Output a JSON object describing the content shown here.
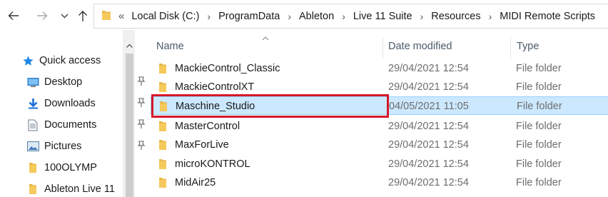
{
  "toolbar": {
    "back_icon": "arrow-left-icon",
    "forward_icon": "arrow-right-icon",
    "recent_icon": "chevron-down-icon",
    "up_icon": "arrow-up-icon"
  },
  "address_bar": {
    "overflow": "«",
    "crumbs": [
      "Local Disk (C:)",
      "ProgramData",
      "Ableton",
      "Live 11 Suite",
      "Resources",
      "MIDI Remote Scripts"
    ],
    "separator": "›"
  },
  "sidebar": {
    "items": [
      {
        "label": "Quick access",
        "icon": "star-icon",
        "pinned": false
      },
      {
        "label": "Desktop",
        "icon": "desktop-icon",
        "pinned": true
      },
      {
        "label": "Downloads",
        "icon": "download-icon",
        "pinned": true
      },
      {
        "label": "Documents",
        "icon": "documents-icon",
        "pinned": true
      },
      {
        "label": "Pictures",
        "icon": "pictures-icon",
        "pinned": true
      },
      {
        "label": "100OLYMP",
        "icon": "folder-icon",
        "pinned": false
      },
      {
        "label": "Ableton Live 11",
        "icon": "folder-icon",
        "pinned": false
      }
    ]
  },
  "file_list": {
    "columns": {
      "name": "Name",
      "date": "Date modified",
      "type": "Type"
    },
    "sort_indicator": "^",
    "rows": [
      {
        "name": "MackieControl_Classic",
        "date": "29/04/2021 12:54",
        "type": "File folder",
        "selected": false
      },
      {
        "name": "MackieControlXT",
        "date": "29/04/2021 12:54",
        "type": "File folder",
        "selected": false
      },
      {
        "name": "Maschine_Studio",
        "date": "04/05/2021 11:05",
        "type": "File folder",
        "selected": true
      },
      {
        "name": "MasterControl",
        "date": "29/04/2021 12:54",
        "type": "File folder",
        "selected": false
      },
      {
        "name": "MaxForLive",
        "date": "29/04/2021 12:54",
        "type": "File folder",
        "selected": false
      },
      {
        "name": "microKONTROL",
        "date": "29/04/2021 12:54",
        "type": "File folder",
        "selected": false
      },
      {
        "name": "MidAir25",
        "date": "29/04/2021 12:54",
        "type": "File folder",
        "selected": false
      }
    ]
  },
  "colors": {
    "selection_bg": "#cce8ff",
    "selection_border": "#99d1ff",
    "highlight_box": "#d7182a",
    "folder": "#e8b84a"
  }
}
